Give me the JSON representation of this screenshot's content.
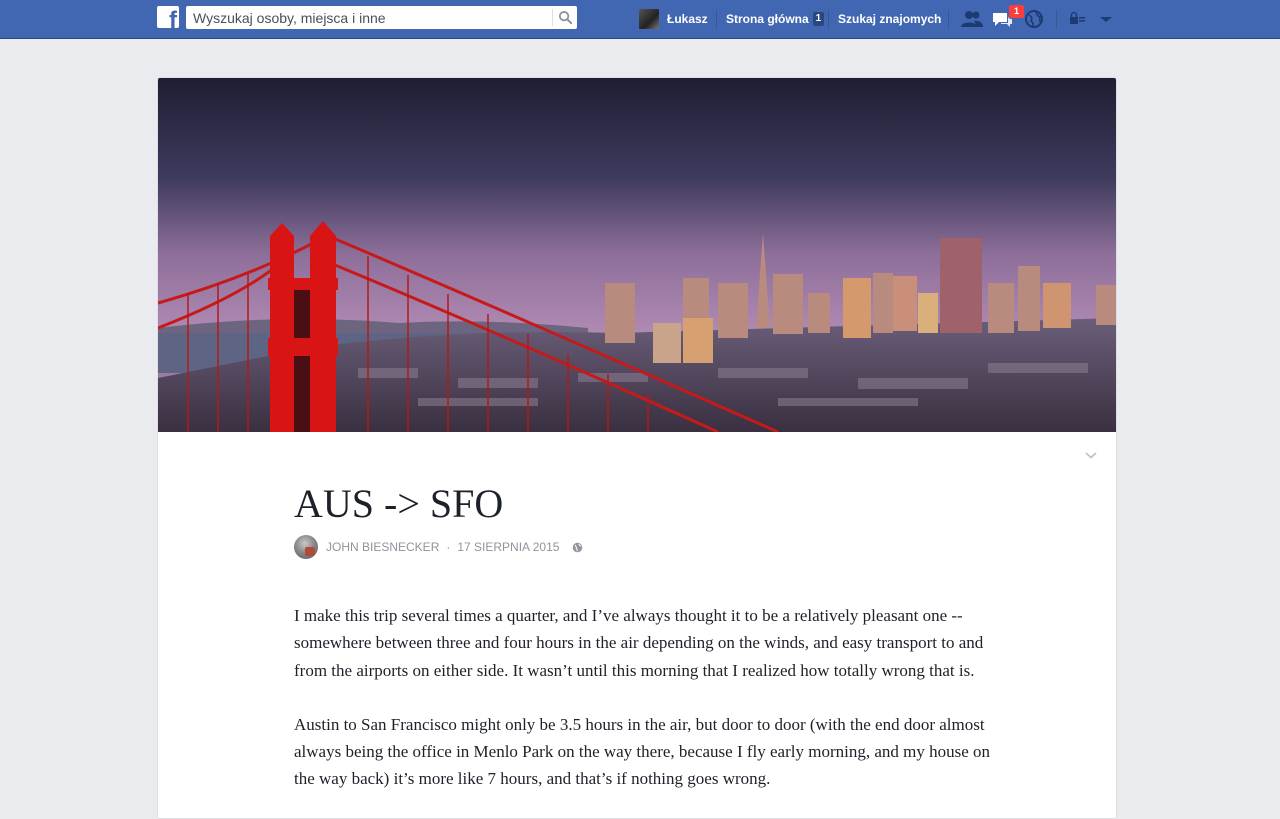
{
  "topbar": {
    "logo_letter": "f",
    "search": {
      "placeholder": "Wyszukaj osoby, miejsca i inne",
      "value": ""
    },
    "profile_name": "Łukasz",
    "home_label": "Strona główna",
    "home_count": "1",
    "find_friends_label": "Szukaj znajomych",
    "messages_count": "1",
    "icons": [
      "facebook-logo-icon",
      "search-icon",
      "friend-requests-icon",
      "messages-icon",
      "notifications-globe-icon",
      "privacy-lock-icon",
      "account-menu-chevron-icon"
    ],
    "color": "#4267b2"
  },
  "article": {
    "cover_image": "golden-gate-bridge-san-francisco-skyline",
    "title": "AUS -> SFO",
    "author": "JOHN BIESNECKER",
    "date": "17 SIERPNIA 2015",
    "visibility_icon": "public-globe-icon",
    "paragraphs": [
      "I make this trip several times a quarter, and I’ve always thought it to be a relatively pleasant one -- somewhere between three and four hours in the air depending on the winds, and easy transport to and from the airports on either side. It wasn’t until this morning that I realized how totally wrong that is.",
      "Austin to San Francisco might only be 3.5 hours in the air, but door to door (with the end door almost always being the office in Menlo Park on the way there, because I fly early morning, and my house on the way back) it’s more like 7 hours, and that’s if nothing goes wrong."
    ]
  }
}
